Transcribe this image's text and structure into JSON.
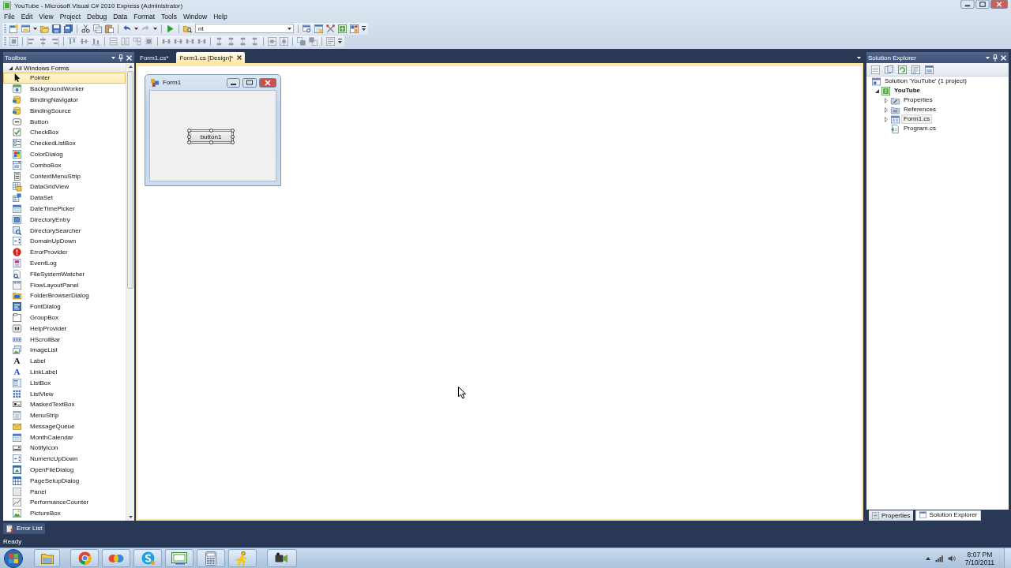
{
  "window": {
    "title": "YouTube - Microsoft Visual C# 2010 Express (Administrator)"
  },
  "menu": [
    "File",
    "Edit",
    "View",
    "Project",
    "Debug",
    "Data",
    "Format",
    "Tools",
    "Window",
    "Help"
  ],
  "toolbar": {
    "config_combo": {
      "value": "nt"
    }
  },
  "toolbox": {
    "title": "Toolbox",
    "group": {
      "label": "All Windows Forms",
      "expanded": true,
      "items": [
        {
          "label": "Pointer",
          "selected": true
        },
        {
          "label": "BackgroundWorker",
          "selected": false
        },
        {
          "label": "BindingNavigator",
          "selected": false
        },
        {
          "label": "BindingSource",
          "selected": false
        },
        {
          "label": "Button",
          "selected": false
        },
        {
          "label": "CheckBox",
          "selected": false
        },
        {
          "label": "CheckedListBox",
          "selected": false
        },
        {
          "label": "ColorDialog",
          "selected": false
        },
        {
          "label": "ComboBox",
          "selected": false
        },
        {
          "label": "ContextMenuStrip",
          "selected": false
        },
        {
          "label": "DataGridView",
          "selected": false
        },
        {
          "label": "DataSet",
          "selected": false
        },
        {
          "label": "DateTimePicker",
          "selected": false
        },
        {
          "label": "DirectoryEntry",
          "selected": false
        },
        {
          "label": "DirectorySearcher",
          "selected": false
        },
        {
          "label": "DomainUpDown",
          "selected": false
        },
        {
          "label": "ErrorProvider",
          "selected": false
        },
        {
          "label": "EventLog",
          "selected": false
        },
        {
          "label": "FileSystemWatcher",
          "selected": false
        },
        {
          "label": "FlowLayoutPanel",
          "selected": false
        },
        {
          "label": "FolderBrowserDialog",
          "selected": false
        },
        {
          "label": "FontDialog",
          "selected": false
        },
        {
          "label": "GroupBox",
          "selected": false
        },
        {
          "label": "HelpProvider",
          "selected": false
        },
        {
          "label": "HScrollBar",
          "selected": false
        },
        {
          "label": "ImageList",
          "selected": false
        },
        {
          "label": "Label",
          "glyph": "A",
          "selected": false
        },
        {
          "label": "LinkLabel",
          "glyph": "A",
          "selected": false
        },
        {
          "label": "ListBox",
          "selected": false
        },
        {
          "label": "ListView",
          "selected": false
        },
        {
          "label": "MaskedTextBox",
          "selected": false
        },
        {
          "label": "MenuStrip",
          "selected": false
        },
        {
          "label": "MessageQueue",
          "selected": false
        },
        {
          "label": "MonthCalendar",
          "selected": false
        },
        {
          "label": "NotifyIcon",
          "selected": false
        },
        {
          "label": "NumericUpDown",
          "selected": false
        },
        {
          "label": "OpenFileDialog",
          "selected": false
        },
        {
          "label": "PageSetupDialog",
          "selected": false
        },
        {
          "label": "Panel",
          "selected": false
        },
        {
          "label": "PerformanceCounter",
          "selected": false
        },
        {
          "label": "PictureBox",
          "selected": false
        }
      ]
    }
  },
  "document_tabs": [
    {
      "label": "Form1.cs*",
      "selected": false
    },
    {
      "label": "Form1.cs [Design]*",
      "selected": true
    }
  ],
  "designer": {
    "form": {
      "title": "Form1",
      "button": {
        "label": "button1",
        "selected": true
      }
    }
  },
  "solution_explorer": {
    "title": "Solution Explorer",
    "tree": [
      {
        "label": "Solution 'YouTube' (1 project)",
        "kind": "solution",
        "selected": false,
        "children": [
          {
            "label": "YouTube",
            "kind": "project",
            "expanded": true,
            "selected": false,
            "children": [
              {
                "label": "Properties",
                "kind": "properties",
                "expanded": false,
                "selected": false
              },
              {
                "label": "References",
                "kind": "references",
                "expanded": false,
                "selected": false
              },
              {
                "label": "Form1.cs",
                "kind": "form",
                "expanded": false,
                "selected": true
              },
              {
                "label": "Program.cs",
                "kind": "code",
                "selected": false
              }
            ]
          }
        ]
      }
    ]
  },
  "tool_tabs": [
    {
      "label": "Properties",
      "selected": false
    },
    {
      "label": "Solution Explorer",
      "selected": true
    }
  ],
  "error_list": {
    "label": "Error List"
  },
  "status_bar": {
    "text": "Ready"
  },
  "taskbar": {
    "time": "8:07 PM",
    "date": "7/10/2011"
  }
}
